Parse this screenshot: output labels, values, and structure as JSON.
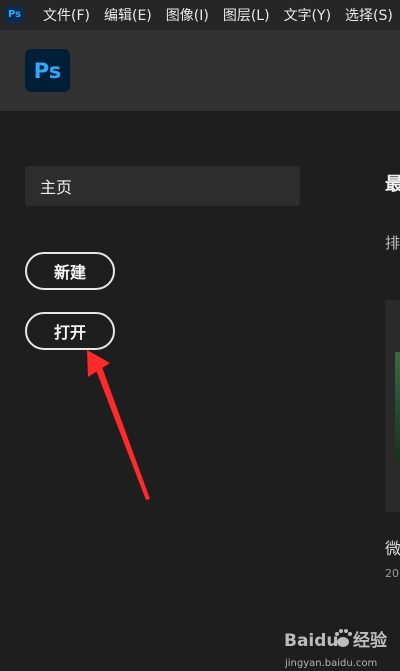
{
  "menubar": {
    "app_icon_text": "Ps",
    "items": [
      "文件(F)",
      "编辑(E)",
      "图像(I)",
      "图层(L)",
      "文字(Y)",
      "选择(S)"
    ]
  },
  "header": {
    "logo_text": "Ps",
    "logo_icon": "photoshop-logo-icon"
  },
  "sidebar": {
    "home_label": "主页",
    "new_button": "新建",
    "open_button": "打开"
  },
  "recent": {
    "title": "最",
    "sort_label": "排",
    "file_name": "微",
    "file_date": "20"
  },
  "annotation": {
    "arrow_color": "#ff2a2a",
    "arrow_icon": "red-arrow-pointer"
  },
  "watermark": {
    "brand": "Baidu",
    "brand_cn": "经验",
    "url": "jingyan.baidu.com"
  },
  "colors": {
    "background": "#1e1e1e",
    "menubar": "#262626",
    "header": "#323232",
    "accent": "#31a8ff"
  }
}
